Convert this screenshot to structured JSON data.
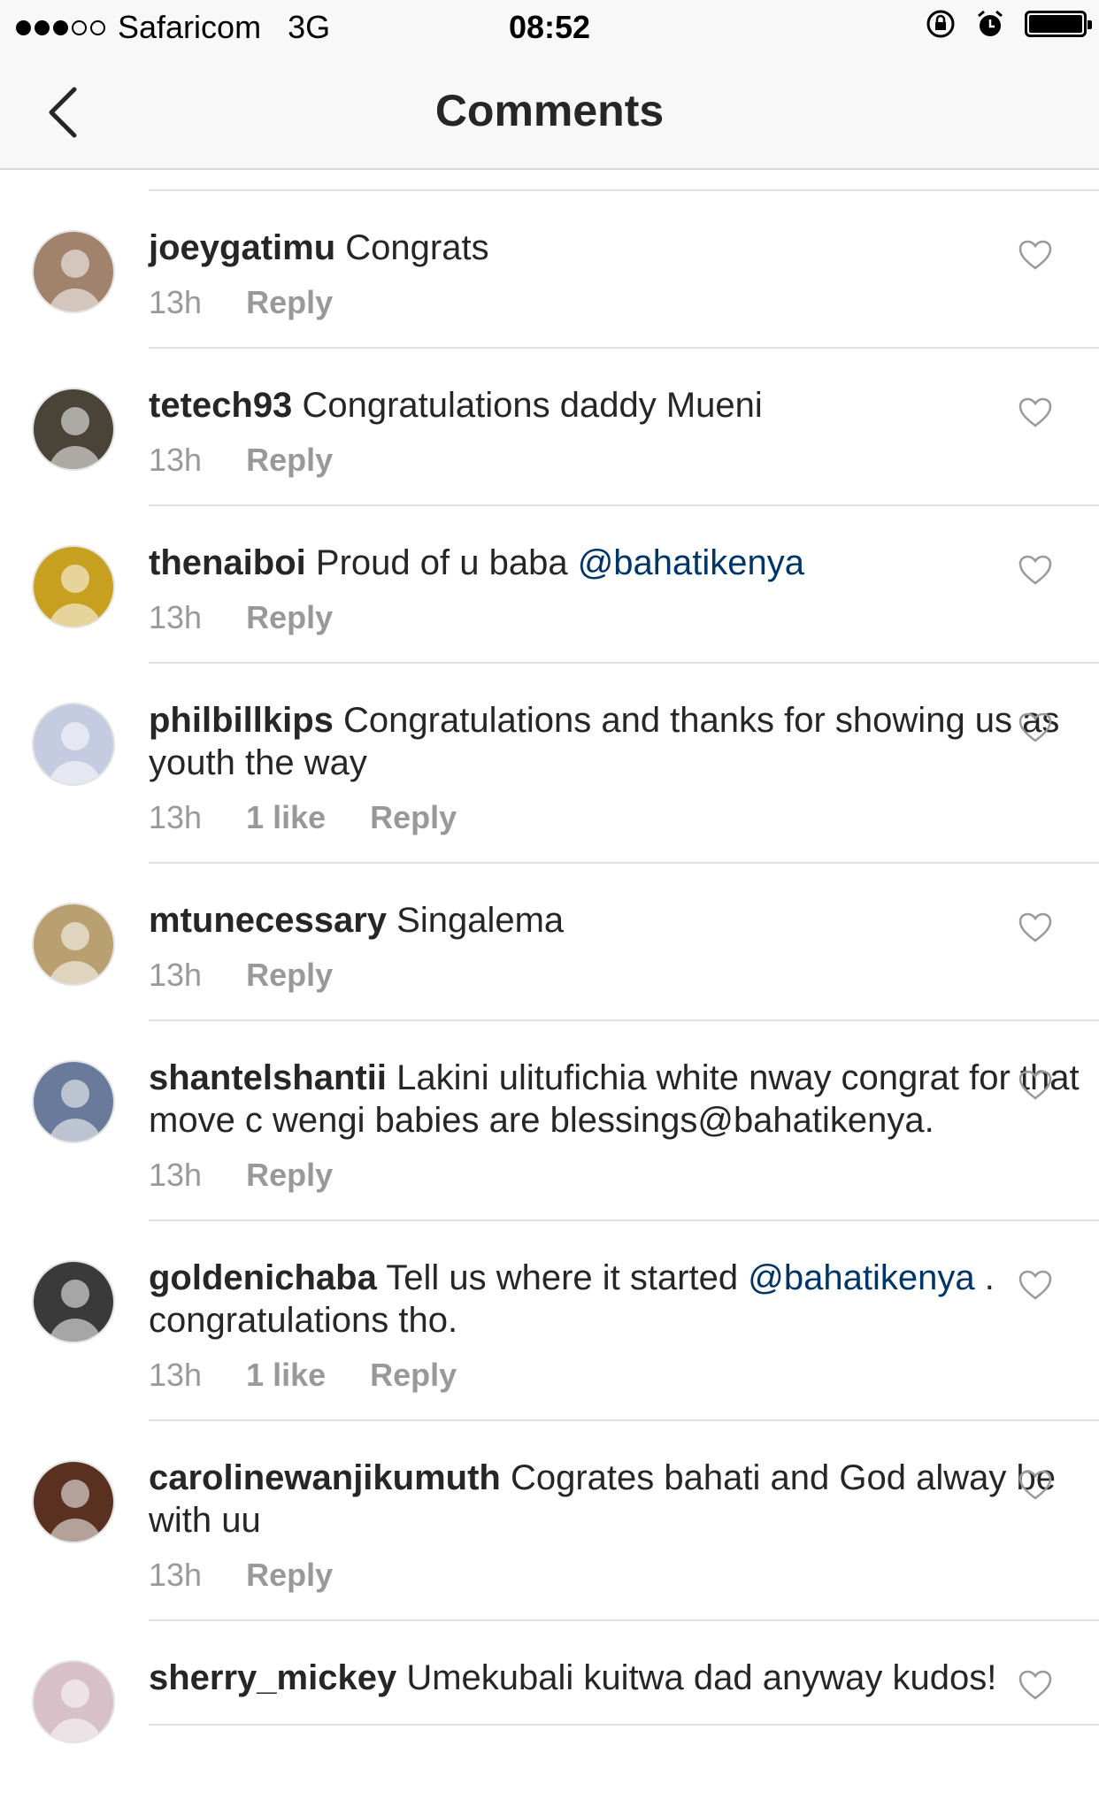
{
  "status_bar": {
    "carrier": "Safaricom",
    "network": "3G",
    "time": "08:52"
  },
  "nav": {
    "title": "Comments"
  },
  "comments": [
    {
      "user": "joeygatimu",
      "text": "Congrats",
      "mention": "",
      "text_after": "",
      "time": "13h",
      "likes": "",
      "reply": "Reply",
      "avatar_color": "#a0826d"
    },
    {
      "user": "tetech93",
      "text": "Congratulations daddy Mueni",
      "mention": "",
      "text_after": "",
      "time": "13h",
      "likes": "",
      "reply": "Reply",
      "avatar_color": "#4a4438"
    },
    {
      "user": "thenaiboi",
      "text": "Proud of u baba",
      "mention": "@bahatikenya",
      "text_after": "",
      "time": "13h",
      "likes": "",
      "reply": "Reply",
      "avatar_color": "#c8a020"
    },
    {
      "user": "philbillkips",
      "text": "Congratulations and thanks for showing us as youth the way",
      "mention": "",
      "text_after": "",
      "time": "13h",
      "likes": "1 like",
      "reply": "Reply",
      "avatar_color": "#c5cbe0"
    },
    {
      "user": "mtunecessary",
      "text": "Singalema",
      "mention": "",
      "text_after": "",
      "time": "13h",
      "likes": "",
      "reply": "Reply",
      "avatar_color": "#b8a070"
    },
    {
      "user": "shantelshantii",
      "text": "Lakini ulitufichia white nway congrat for that move c wengi babies are blessings@bahatikenya.",
      "mention": "",
      "text_after": "",
      "time": "13h",
      "likes": "",
      "reply": "Reply",
      "avatar_color": "#6a7a9a"
    },
    {
      "user": "goldenichaba",
      "text": "Tell us where it started",
      "mention": "@bahatikenya",
      "text_after": ". congratulations tho.",
      "time": "13h",
      "likes": "1 like",
      "reply": "Reply",
      "avatar_color": "#3a3a3a"
    },
    {
      "user": "carolinewanjikumuth",
      "text": "Cogrates bahati and God alway be with uu",
      "mention": "",
      "text_after": "",
      "time": "13h",
      "likes": "",
      "reply": "Reply",
      "avatar_color": "#5a3020"
    },
    {
      "user": "sherry_mickey",
      "text": "Umekubali kuitwa dad anyway kudos!",
      "mention": "",
      "text_after": "",
      "time": "",
      "likes": "",
      "reply": "",
      "avatar_color": "#d8c0c8"
    }
  ]
}
